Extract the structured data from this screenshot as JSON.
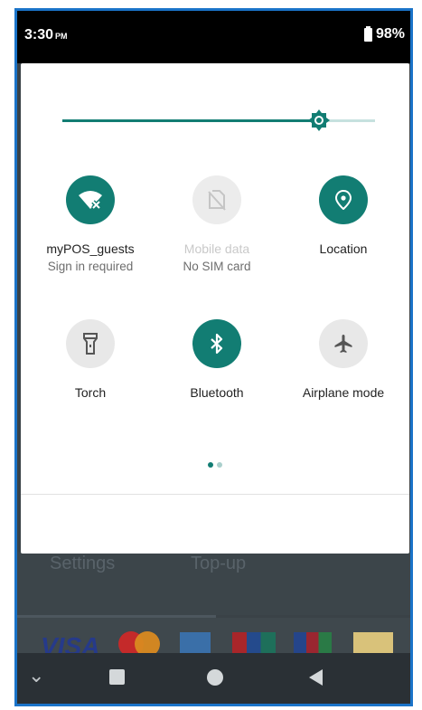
{
  "status_bar": {
    "time": "3:30",
    "ampm": "PM",
    "battery": "98%"
  },
  "brightness": {
    "level": 0.82
  },
  "tiles": [
    {
      "label": "myPOS_guests",
      "sub": "Sign in required",
      "icon": "wifi-alert-icon",
      "state": "on"
    },
    {
      "label": "Mobile data",
      "sub": "No SIM card",
      "icon": "no-sim-icon",
      "state": "disabled"
    },
    {
      "label": "Location",
      "sub": "",
      "icon": "location-pin-icon",
      "state": "on"
    },
    {
      "label": "Torch",
      "sub": "",
      "icon": "flashlight-icon",
      "state": "off"
    },
    {
      "label": "Bluetooth",
      "sub": "",
      "icon": "bluetooth-icon",
      "state": "on"
    },
    {
      "label": "Airplane mode",
      "sub": "",
      "icon": "airplane-icon",
      "state": "off"
    }
  ],
  "page_indicator": {
    "pages": 2,
    "current": 1
  },
  "background_app": {
    "tab_settings": "Settings",
    "tab_topup": "Top-up",
    "card_brands": [
      "VISA",
      "Mastercard",
      "American Express",
      "UnionPay",
      "JCB",
      "Bancontact"
    ]
  },
  "colors": {
    "accent": "#127d73",
    "tile_off": "#e8e8e8"
  }
}
